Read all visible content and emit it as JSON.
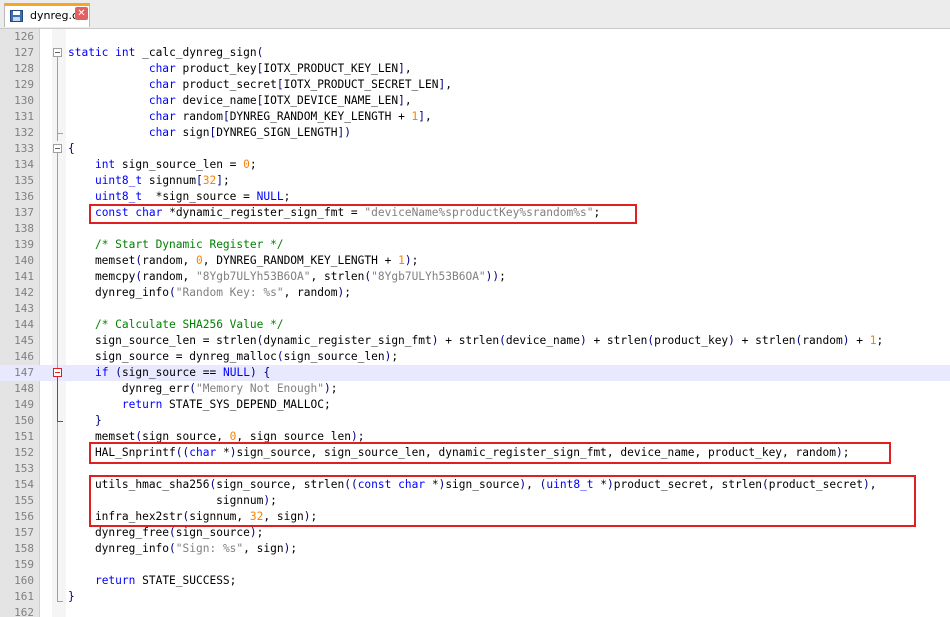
{
  "tab": {
    "label": "dynreg.c"
  },
  "editor": {
    "lines": [
      {
        "num": "126",
        "code": ""
      },
      {
        "num": "127",
        "code": "static int _calc_dynreg_sign("
      },
      {
        "num": "128",
        "code": "            char product_key[IOTX_PRODUCT_KEY_LEN],"
      },
      {
        "num": "129",
        "code": "            char product_secret[IOTX_PRODUCT_SECRET_LEN],"
      },
      {
        "num": "130",
        "code": "            char device_name[IOTX_DEVICE_NAME_LEN],"
      },
      {
        "num": "131",
        "code": "            char random[DYNREG_RANDOM_KEY_LENGTH + 1],"
      },
      {
        "num": "132",
        "code": "            char sign[DYNREG_SIGN_LENGTH])"
      },
      {
        "num": "133",
        "code": "{"
      },
      {
        "num": "134",
        "code": "    int sign_source_len = 0;"
      },
      {
        "num": "135",
        "code": "    uint8_t signnum[32];"
      },
      {
        "num": "136",
        "code": "    uint8_t  *sign_source = NULL;"
      },
      {
        "num": "137",
        "code": "    const char *dynamic_register_sign_fmt = \"deviceName%sproductKey%srandom%s\";"
      },
      {
        "num": "138",
        "code": ""
      },
      {
        "num": "139",
        "code": "    /* Start Dynamic Register */"
      },
      {
        "num": "140",
        "code": "    memset(random, 0, DYNREG_RANDOM_KEY_LENGTH + 1);"
      },
      {
        "num": "141",
        "code": "    memcpy(random, \"8Ygb7ULYh53B6OA\", strlen(\"8Ygb7ULYh53B6OA\"));"
      },
      {
        "num": "142",
        "code": "    dynreg_info(\"Random Key: %s\", random);"
      },
      {
        "num": "143",
        "code": ""
      },
      {
        "num": "144",
        "code": "    /* Calculate SHA256 Value */"
      },
      {
        "num": "145",
        "code": "    sign_source_len = strlen(dynamic_register_sign_fmt) + strlen(device_name) + strlen(product_key) + strlen(random) + 1;"
      },
      {
        "num": "146",
        "code": "    sign_source = dynreg_malloc(sign_source_len);"
      },
      {
        "num": "147",
        "code": "    if (sign_source == NULL) {"
      },
      {
        "num": "148",
        "code": "        dynreg_err(\"Memory Not Enough\");"
      },
      {
        "num": "149",
        "code": "        return STATE_SYS_DEPEND_MALLOC;"
      },
      {
        "num": "150",
        "code": "    }"
      },
      {
        "num": "151",
        "code": "    memset(sign_source, 0, sign_source_len);"
      },
      {
        "num": "152",
        "code": "    HAL_Snprintf((char *)sign_source, sign_source_len, dynamic_register_sign_fmt, device_name, product_key, random);"
      },
      {
        "num": "153",
        "code": ""
      },
      {
        "num": "154",
        "code": "    utils_hmac_sha256(sign_source, strlen((const char *)sign_source), (uint8_t *)product_secret, strlen(product_secret),"
      },
      {
        "num": "155",
        "code": "                      signnum);"
      },
      {
        "num": "156",
        "code": "    infra_hex2str(signnum, 32, sign);"
      },
      {
        "num": "157",
        "code": "    dynreg_free(sign_source);"
      },
      {
        "num": "158",
        "code": "    dynreg_info(\"Sign: %s\", sign);"
      },
      {
        "num": "159",
        "code": ""
      },
      {
        "num": "160",
        "code": "    return STATE_SUCCESS;"
      },
      {
        "num": "161",
        "code": "}"
      },
      {
        "num": "162",
        "code": ""
      }
    ]
  },
  "colors": {
    "keyword": "#0000ff",
    "number": "#ff8000",
    "string": "#808080",
    "comment": "#008000",
    "highlight_box": "#e02020",
    "current_line": "#e8e8ff",
    "tab_accent": "#f6a623"
  },
  "icons": {
    "tab_file": "save-disk-icon",
    "tab_close": "close-icon"
  }
}
